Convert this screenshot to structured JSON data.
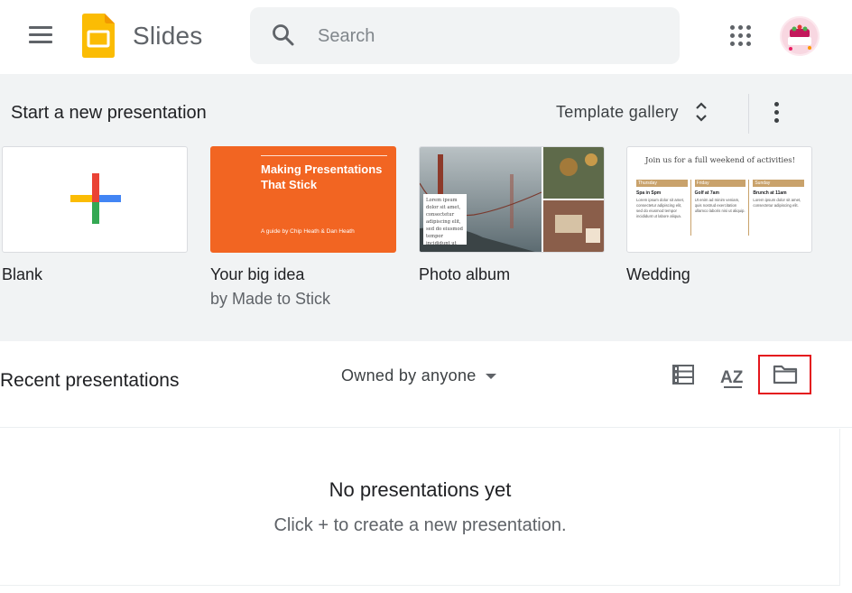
{
  "header": {
    "app_title": "Slides",
    "search_placeholder": "Search",
    "brand_color": "#FBBC04",
    "icons": [
      "menu-icon",
      "slides-logo-icon",
      "search-icon",
      "apps-grid-icon",
      "avatar"
    ]
  },
  "templates_section": {
    "title": "Start a new presentation",
    "gallery_label": "Template gallery",
    "background": "#f1f3f4",
    "templates": [
      {
        "name": "Blank",
        "sub": ""
      },
      {
        "name": "Your big idea",
        "sub": "by Made to Stick",
        "thumb_title": "Making Presentations That Stick",
        "thumb_byline": "A guide by Chip Heath & Dan Heath",
        "thumb_color": "#f26522"
      },
      {
        "name": "Photo album",
        "sub": "",
        "thumb_caption": "Lorem ipsum dolor sit amet, consectetur adipiscing elit, sed do eiusmod tempor incididunt ut labore"
      },
      {
        "name": "Wedding",
        "sub": "",
        "thumb_heading": "Join us for a full weekend of activities!",
        "thumb_columns": [
          {
            "day": "Thursday",
            "title": "Spa in Spm",
            "body": "Lorem ipsum dolor sit amet, consectetur adipiscing elit, sed do eiusmod tempor incididunt ut labore aliqua."
          },
          {
            "day": "Friday",
            "title": "Golf at 7am",
            "body": "Ut enim ad minim veniam, quis nostrud exercitation ullamco laboris nisi ut aliquip."
          },
          {
            "day": "Sunday",
            "title": "Brunch at 11am",
            "body": "Lorem ipsum dolor sit amet, consectetur adipiscing elit."
          }
        ]
      }
    ]
  },
  "recent": {
    "title": "Recent presentations",
    "owner_filter": "Owned by anyone",
    "sort_label": "AZ",
    "empty_title": "No presentations yet",
    "empty_hint": "Click + to create a new presentation.",
    "highlight_color": "#e4161d"
  }
}
